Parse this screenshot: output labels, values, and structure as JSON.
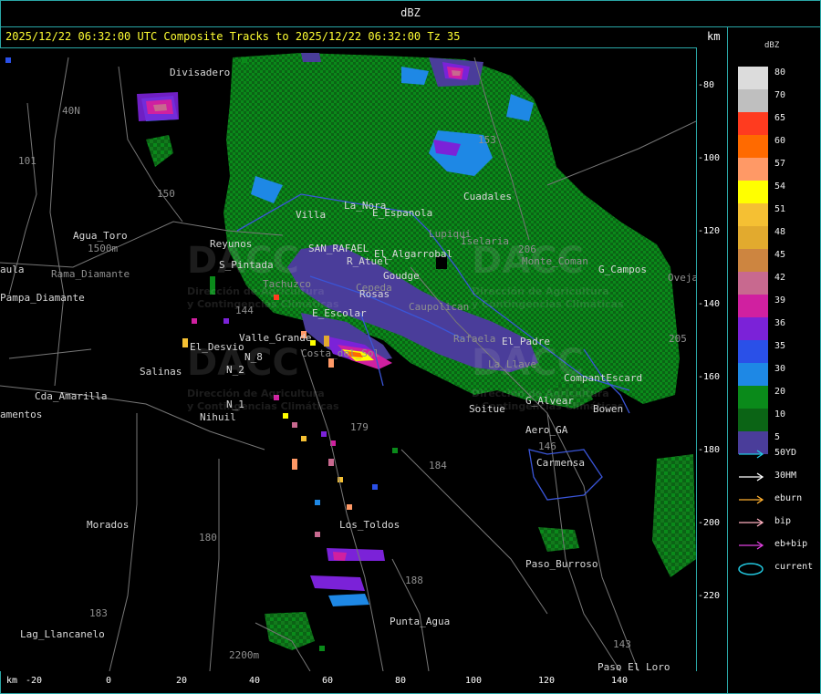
{
  "window": {
    "title": "dBZ"
  },
  "header": {
    "text": "2025/12/22 06:32:00 UTC Composite Tracks to 2025/12/22 06:32:00 Tz 35",
    "km_label": "km"
  },
  "axes": {
    "x_unit": "km",
    "x_ticks": [
      "-20",
      "0",
      "20",
      "40",
      "60",
      "80",
      "100",
      "120",
      "140"
    ],
    "y_ticks": [
      "-80",
      "-100",
      "-120",
      "-140",
      "-160",
      "-180",
      "-200",
      "-220"
    ]
  },
  "colorbar": {
    "title": "dBZ",
    "levels": [
      {
        "label": "80",
        "color": "#dcdcdc"
      },
      {
        "label": "70",
        "color": "#bfbfbf"
      },
      {
        "label": "65",
        "color": "#ff3b1f"
      },
      {
        "label": "60",
        "color": "#ff6a00"
      },
      {
        "label": "57",
        "color": "#ff9966"
      },
      {
        "label": "54",
        "color": "#ffff00"
      },
      {
        "label": "51",
        "color": "#f5c033"
      },
      {
        "label": "48",
        "color": "#e2aa2e"
      },
      {
        "label": "45",
        "color": "#cd8540"
      },
      {
        "label": "42",
        "color": "#c8698f"
      },
      {
        "label": "39",
        "color": "#d020a0"
      },
      {
        "label": "36",
        "color": "#7b22d8"
      },
      {
        "label": "35",
        "color": "#2a50e8"
      },
      {
        "label": "30",
        "color": "#1e88e5"
      },
      {
        "label": "20",
        "color": "#0a8a1a"
      },
      {
        "label": "10",
        "color": "#0b6415"
      },
      {
        "label": "5",
        "color": "#4a3d9a"
      }
    ]
  },
  "track_legend": [
    {
      "label": "50YD",
      "color": "#22c8e0",
      "type": "arrow"
    },
    {
      "label": "30HM",
      "color": "#ffffff",
      "type": "arrow"
    },
    {
      "label": "eburn",
      "color": "#ffb030",
      "type": "arrow"
    },
    {
      "label": "bip",
      "color": "#ffb0c0",
      "type": "arrow"
    },
    {
      "label": "eb+bip",
      "color": "#e040e0",
      "type": "arrow"
    },
    {
      "label": "current",
      "color": "#22c8e0",
      "type": "ellipse"
    }
  ],
  "places": [
    "Divisadero",
    "Agua_Toro",
    "1500m",
    "Rama_Diamante",
    "Pampa_Diamante",
    "Reyunos",
    "S_Pintada",
    "El_Desvio",
    "Valle_Grande",
    "Salinas",
    "N_2",
    "N_1",
    "Nihuil",
    "Cda_Amarilla",
    "amentos",
    "Morados",
    "Lag_Llancanelo",
    "2200m",
    "Punta_Agua",
    "Los_Toldos",
    "Paso_Burroso",
    "Paso_El_Loro",
    "Carmensa",
    "Aero_GA",
    "G_Alvear",
    "Bowen",
    "Soitue",
    "CompantEscard",
    "Cuadales",
    "Monte_Coman",
    "G_Campos",
    "Villa",
    "La_Nora",
    "E_Espanola",
    "SAN_RAFAEL",
    "El_Algarrobal",
    "Rosas",
    "Caupolican",
    "E_Escolar",
    "R_Atuel",
    "Cepeda",
    "Tachuzco",
    "El_Padre",
    "Rafaela",
    "Costa_del_Sol",
    "La_Llave",
    "Goudge",
    "Lupiqui",
    "Iselaria",
    "Ovejas",
    "aula",
    "40N",
    "101",
    "N_8",
    "150",
    "153",
    "184",
    "179",
    "180",
    "183",
    "188",
    "143",
    "144",
    "146",
    "205",
    "206"
  ],
  "watermark": {
    "brand": "DACC",
    "line1": "Dirección de Agricultura",
    "line2": "y Contingencias Climáticas"
  }
}
